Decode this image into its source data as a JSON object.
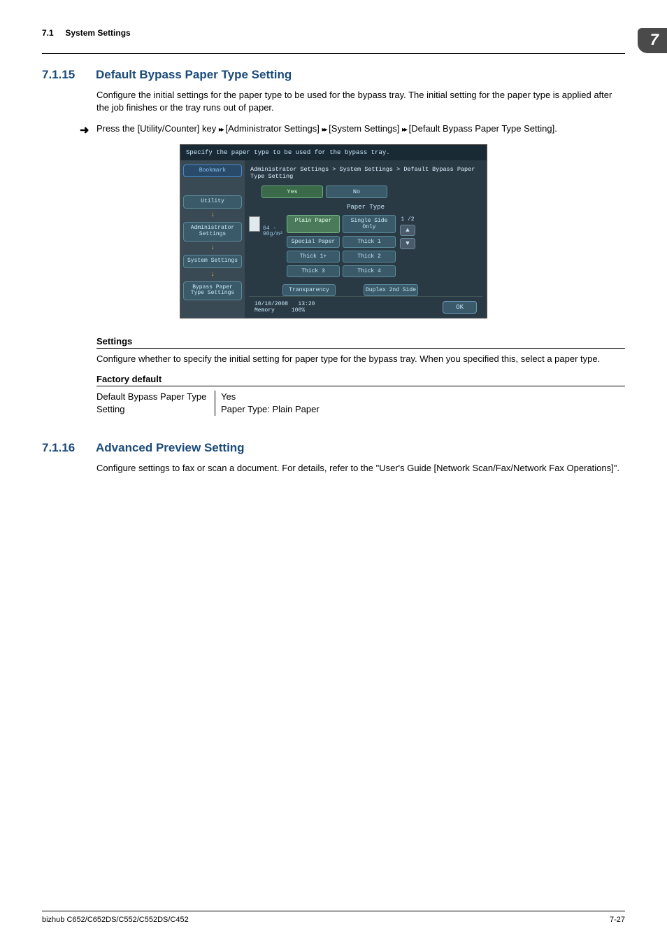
{
  "header": {
    "section_num": "7.1",
    "section_title": "System Settings",
    "chapter_badge": "7"
  },
  "sec_7_1_15": {
    "num": "7.1.15",
    "title": "Default Bypass Paper Type Setting",
    "intro": "Configure the initial settings for the paper type to be used for the bypass tray. The initial setting for the paper type is applied after the job finishes or the tray runs out of paper.",
    "nav_prefix": "Press the [Utility/Counter] key ",
    "nav_seg1": " [Administrator Settings] ",
    "nav_seg2": " [System Settings] ",
    "nav_seg3": " [Default Bypass Paper Type Setting].",
    "settings_head": "Settings",
    "settings_body": "Configure whether to specify the initial setting for paper type for the bypass tray. When you specified this, select a paper type.",
    "factory_head": "Factory default",
    "factory_left": "Default Bypass Paper Type Setting",
    "factory_r1": "Yes",
    "factory_r2": "Paper Type: Plain Paper"
  },
  "screenshot": {
    "top_text": "Specify the paper type to be used for the bypass tray.",
    "bookmark": "Bookmark",
    "utility": "Utility",
    "admin": "Administrator Settings",
    "sys": "System Settings",
    "bypass": "Bypass Paper Type Settings",
    "breadcrumb": "Administrator Settings > System Settings > Default Bypass Paper Type Setting",
    "yes": "Yes",
    "no": "No",
    "paper_type": "Paper Type",
    "weight": "64 - 90g/m²",
    "plain": "Plain Paper",
    "single": "Single Side Only",
    "special": "Special Paper",
    "thick1": "Thick 1",
    "thick1p": "Thick 1+",
    "thick2": "Thick 2",
    "thick3": "Thick 3",
    "thick4": "Thick 4",
    "transparency": "Transparency",
    "duplex": "Duplex 2nd Side",
    "page_ind": "1 /2",
    "date": "10/10/2008",
    "time": "13:20",
    "mem_label": "Memory",
    "mem_val": "100%",
    "ok": "OK"
  },
  "sec_7_1_16": {
    "num": "7.1.16",
    "title": "Advanced Preview Setting",
    "body": "Configure settings to fax or scan a document. For details, refer to the \"User's Guide [Network Scan/Fax/Network Fax Operations]\"."
  },
  "footer": {
    "left": "bizhub C652/C652DS/C552/C552DS/C452",
    "right": "7-27"
  }
}
